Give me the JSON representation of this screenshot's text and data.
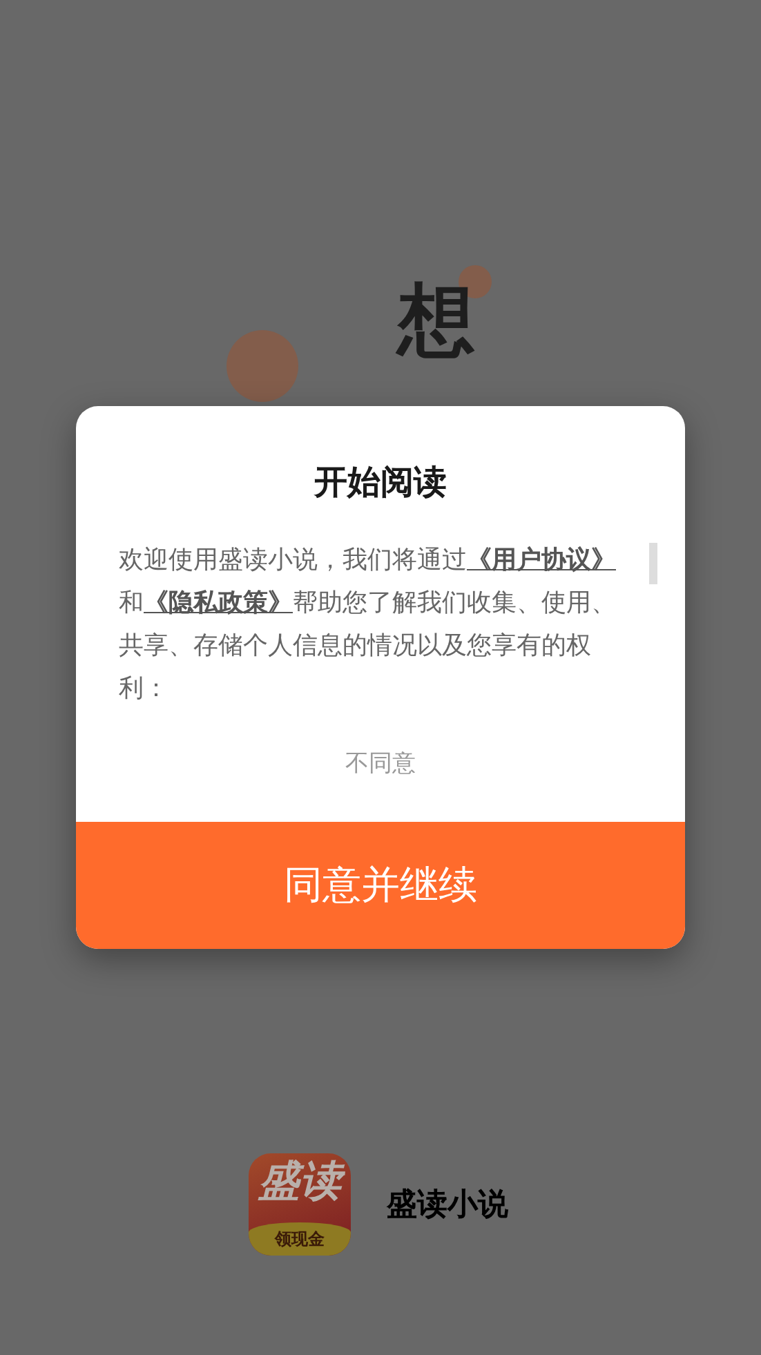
{
  "splash": {
    "headline_chars": [
      "想"
    ]
  },
  "dialog": {
    "title": "开始阅读",
    "paragraph": [
      {
        "kind": "text",
        "text": "欢迎使用盛读小说，我们将通过"
      },
      {
        "kind": "link",
        "text": "《用户协议》"
      },
      {
        "kind": "text",
        "text": "和"
      },
      {
        "kind": "link",
        "text": "《隐私政策》"
      },
      {
        "kind": "text",
        "text": "帮助您了解我们收集、使用、共享、存储个人信息的情况以及您享有的权利："
      }
    ],
    "decline": "不同意",
    "accept": "同意并继续"
  },
  "app": {
    "icon_title": "盛读",
    "icon_badge": "领现金",
    "name": "盛读小说"
  }
}
